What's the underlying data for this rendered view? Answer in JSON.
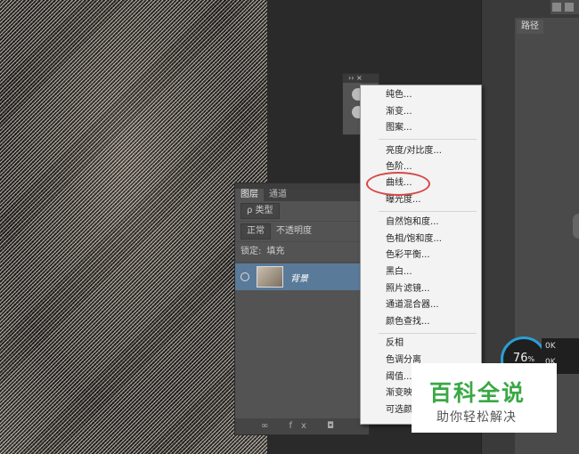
{
  "right_panel": {
    "path_tab": "路径"
  },
  "float_panel": {
    "header": "›› ×"
  },
  "layers": {
    "tabs": [
      "图层",
      "通道"
    ],
    "filter_label": "ρ 类型",
    "blend_mode": "正常",
    "opacity_label": "不透明度",
    "lock_label": "锁定:",
    "fill_label": "填充",
    "layer_name": "背景",
    "footer_icons": "∞ fx ◘"
  },
  "menu": {
    "items": [
      "纯色...",
      "渐变...",
      "图案...",
      "亮度/对比度...",
      "色阶...",
      "曲线...",
      "曝光度...",
      "自然饱和度...",
      "色相/饱和度...",
      "色彩平衡...",
      "黑白...",
      "照片滤镜...",
      "通道混合器...",
      "颜色查找...",
      "反相",
      "色调分离",
      "阈值...",
      "渐变映射...",
      "可选颜色..."
    ],
    "highlighted": "曲线..."
  },
  "overlay": {
    "gauge_value": "76",
    "gauge_unit": "%",
    "net_up": "0K",
    "net_down": "0K"
  },
  "watermark": {
    "title": "百科全说",
    "subtitle": "助你轻松解决"
  },
  "colors": {
    "highlight_oval": "#d64848",
    "brand_green": "#3aa845",
    "selected_layer": "#5a7a9a"
  }
}
